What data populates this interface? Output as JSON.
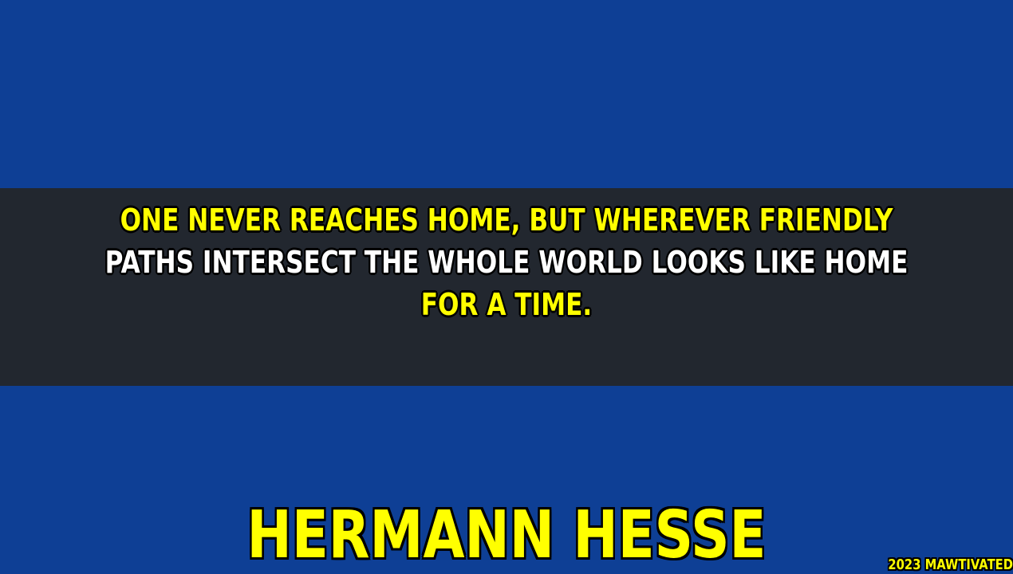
{
  "colors": {
    "background": "#0e3f95",
    "band": "#22272f",
    "highlight": "#ffff00",
    "text_alt": "#ffffff",
    "outline": "#000000"
  },
  "quote": {
    "lines": [
      "ONE NEVER REACHES HOME, BUT WHEREVER FRIENDLY",
      "PATHS INTERSECT THE WHOLE WORLD LOOKS LIKE HOME",
      "FOR A TIME."
    ]
  },
  "author": "HERMANN HESSE",
  "watermark": "2023 MAWTIVATED"
}
